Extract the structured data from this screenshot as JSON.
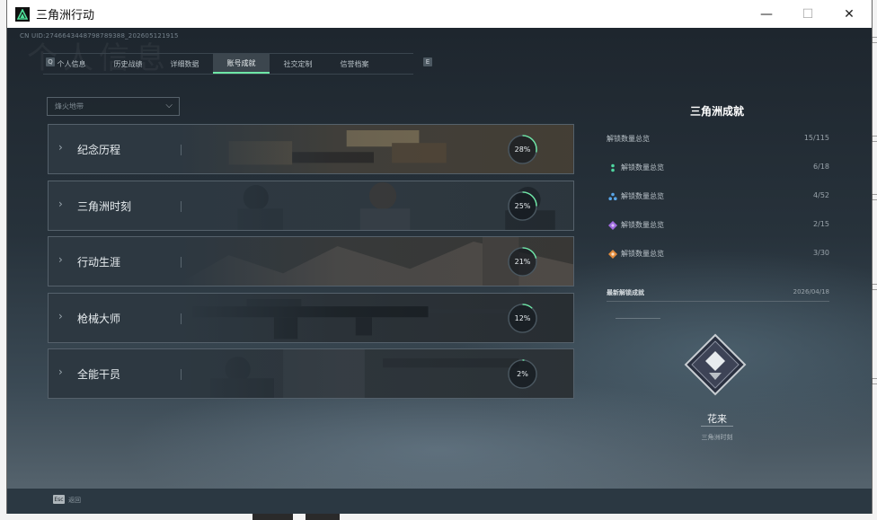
{
  "window": {
    "title": "三角洲行动",
    "minimize": "—",
    "maximize": "☐",
    "close": "✕"
  },
  "header": {
    "uid": "CN UID:2746643448798789388_2026051219​15",
    "bg_word": "个人信息"
  },
  "tabs": [
    {
      "label": "个人信息",
      "active": false
    },
    {
      "label": "历史战绩",
      "active": false
    },
    {
      "label": "详细数据",
      "active": false
    },
    {
      "label": "账号成就",
      "active": true
    },
    {
      "label": "社交定制",
      "active": false
    },
    {
      "label": "信誉档案",
      "active": false
    }
  ],
  "tab_keys": {
    "left": "Q",
    "right": "E"
  },
  "filter": {
    "value": "烽火地带"
  },
  "categories": [
    {
      "label": "纪念历程",
      "progress": 28,
      "progress_text": "28%"
    },
    {
      "label": "三角洲时刻",
      "progress": 25,
      "progress_text": "25%"
    },
    {
      "label": "行动生涯",
      "progress": 21,
      "progress_text": "21%"
    },
    {
      "label": "枪械大师",
      "progress": 12,
      "progress_text": "12%"
    },
    {
      "label": "全能干员",
      "progress": 2,
      "progress_text": "2%"
    }
  ],
  "panel": {
    "title": "三角洲成就",
    "total_label": "解锁数量总览",
    "total_value": "15/115",
    "rows": [
      {
        "label": "解锁数量总览",
        "value": "6/18",
        "icon": "green-tier-icon",
        "color": "#4fd6a0"
      },
      {
        "label": "解锁数量总览",
        "value": "4/52",
        "icon": "blue-tier-icon",
        "color": "#58a6e8"
      },
      {
        "label": "解锁数量总览",
        "value": "2/15",
        "icon": "purple-tier-icon",
        "color": "#a06be0"
      },
      {
        "label": "解锁数量总览",
        "value": "3/30",
        "icon": "orange-tier-icon",
        "color": "#e08a3c"
      }
    ],
    "latest_label": "最新解锁成就",
    "latest_date": "2026/04/18",
    "badge_name": "花来",
    "badge_category": "三角洲时刻"
  },
  "bottombar": {
    "esc_key": "Esc",
    "esc_label": "返回"
  },
  "colors": {
    "accent": "#6ee7a6",
    "ring_track": "#4a5760"
  }
}
